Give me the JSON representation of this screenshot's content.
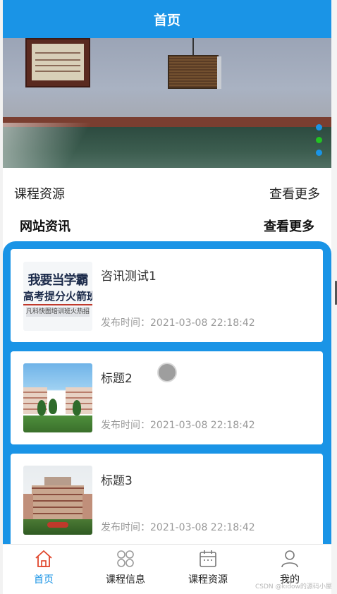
{
  "header": {
    "title": "首页"
  },
  "banner": {
    "indicator_colors": [
      "#1a94e6",
      "#22c322",
      "#1a94e6"
    ]
  },
  "course_section": {
    "title": "课程资源",
    "more": "查看更多"
  },
  "news_section": {
    "title": "网站资讯",
    "more": "查看更多"
  },
  "news": [
    {
      "title": "咨讯测试1",
      "time_label": "发布时间：",
      "time": "2021-03-08 22:18:42",
      "thumb_text": [
        "我要当学霸",
        "高考提分火箭班",
        "凡科快图培训班火热招生"
      ]
    },
    {
      "title": "标题2",
      "time_label": "发布时间：",
      "time": "2021-03-08 22:18:42"
    },
    {
      "title": "标题3",
      "time_label": "发布时间：",
      "time": "2021-03-08 22:18:42"
    }
  ],
  "tabbar": {
    "items": [
      {
        "label": "首页",
        "icon": "home-icon"
      },
      {
        "label": "课程信息",
        "icon": "grid-icon"
      },
      {
        "label": "课程资源",
        "icon": "calendar-icon"
      },
      {
        "label": "我的",
        "icon": "user-icon"
      }
    ],
    "active_index": 0
  },
  "watermark": "CSDN @kidow的源码小屋",
  "colors": {
    "accent": "#1a94e6",
    "inactive_icon": "#9a9a9a",
    "active_icon": "#e0452b"
  }
}
